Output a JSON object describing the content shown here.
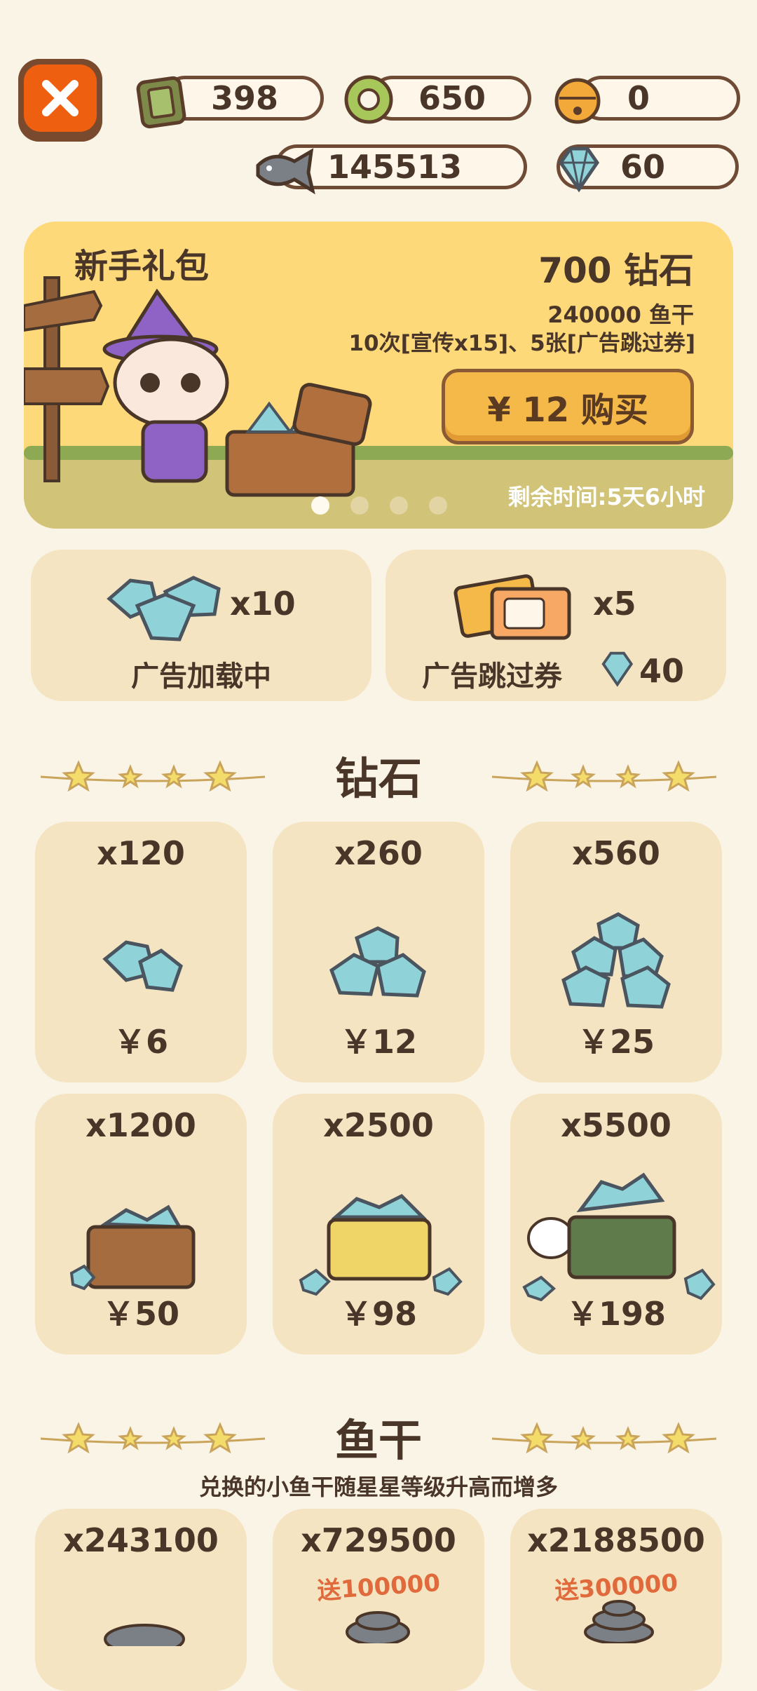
{
  "close": {
    "icon": "close-icon"
  },
  "currencies": {
    "ticket": {
      "icon": "ticket-icon",
      "value": "398"
    },
    "coin": {
      "icon": "ring-coin-icon",
      "value": "650"
    },
    "bell": {
      "icon": "bell-icon",
      "value": "0"
    },
    "fish": {
      "icon": "fish-icon",
      "value": "145513"
    },
    "diamond": {
      "icon": "diamond-icon",
      "value": "60"
    }
  },
  "banner": {
    "title": "新手礼包",
    "diamonds": "700 钻石",
    "fish": "240000 鱼干",
    "extra": "10次[宣传x15]、5张[广告跳过券]",
    "buy_label": "¥ 12 购买",
    "timer": "剩余时间:5天6小时",
    "page_count": 4,
    "active_page": 1
  },
  "ad_cards": [
    {
      "count": "x10",
      "label": "广告加载中",
      "icon": "diamond-pile-icon"
    },
    {
      "count": "x5",
      "label": "广告跳过券",
      "icon": "ad-skip-ticket-icon",
      "cost": "40"
    }
  ],
  "diamond_section": {
    "title": "钻石",
    "items": [
      {
        "qty": "x120",
        "price": "￥6"
      },
      {
        "qty": "x260",
        "price": "￥12"
      },
      {
        "qty": "x560",
        "price": "￥25"
      },
      {
        "qty": "x1200",
        "price": "￥50"
      },
      {
        "qty": "x2500",
        "price": "￥98"
      },
      {
        "qty": "x5500",
        "price": "￥198"
      }
    ]
  },
  "fish_section": {
    "title": "鱼干",
    "subtitle": "兑换的小鱼干随星星等级升高而增多",
    "items": [
      {
        "qty": "x243100",
        "bonus": ""
      },
      {
        "qty": "x729500",
        "bonus": "送100000"
      },
      {
        "qty": "x2188500",
        "bonus": "送300000"
      }
    ]
  },
  "colors": {
    "background": "#faf4e6",
    "card": "#f5e4c1",
    "close": "#ee6010",
    "banner": "#fed97a",
    "buy_button": "#f5b94a",
    "diamond": "#8fd3d9",
    "text": "#4a3629",
    "bonus": "#e06a3c"
  }
}
